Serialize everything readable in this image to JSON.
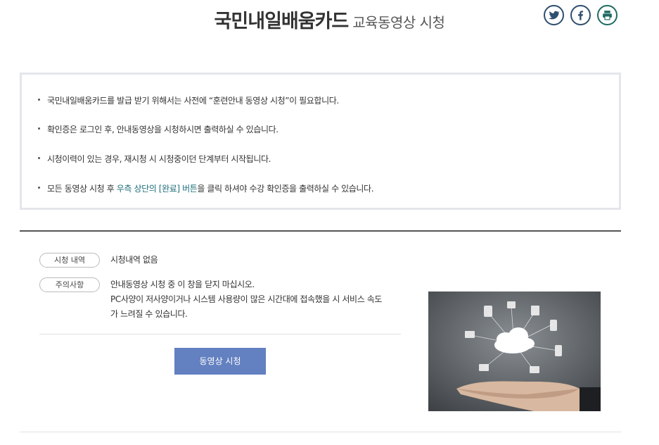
{
  "header": {
    "title_main": "국민내일배움카드",
    "title_sub": "교육동영상 시청"
  },
  "social": [
    {
      "name": "twitter-icon"
    },
    {
      "name": "facebook-icon"
    },
    {
      "name": "print-icon"
    }
  ],
  "notice": {
    "item1": "국민내일배움카드를 발급 받기 위해서는 사전에 “훈련안내 동영상 시청”이 필요합니다.",
    "item2": "확인증은 로그인 후, 안내동영상을 시청하시면 출력하실 수 있습니다.",
    "item3": "시청이력이 있는 경우, 재시청 시 시청중이던 단계부터 시작됩니다.",
    "item4_pre": "모든 동영상 시청 후 ",
    "item4_highlight": "우측 상단의 [완료] 버튼",
    "item4_post": "을 클릭 하셔야 수강 확인증을 출력하실 수 있습니다."
  },
  "history": {
    "label": "시청 내역",
    "value": "시청내역 없음"
  },
  "caution": {
    "label": "주의사항",
    "line1": "안내동영상 시청 중 이 창을 닫지 마십시오.",
    "line2": "PC사양이 저사양이거나 시스템 사용량이 많은 시간대에 접속했을 시 서비스 속도",
    "line3": "가 느려질 수 있습니다."
  },
  "watch_button": "동영상 시청",
  "colors": {
    "accent": "#6380c0",
    "highlight": "#1e6f7a",
    "social_border": "#2f4f6f",
    "print_border": "#1f6b64"
  }
}
